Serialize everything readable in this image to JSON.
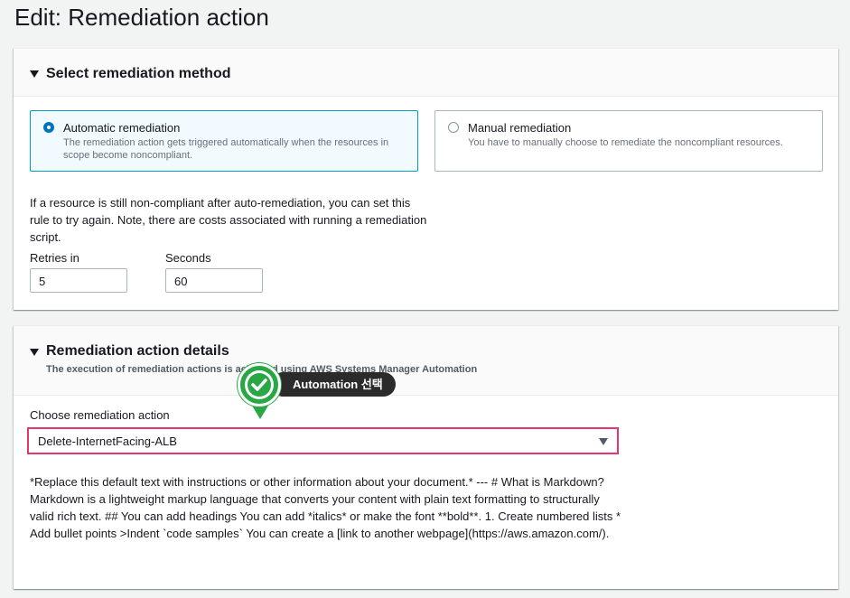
{
  "page": {
    "title": "Edit: Remediation action"
  },
  "method_panel": {
    "title": "Select remediation method",
    "options": [
      {
        "title": "Automatic remediation",
        "description": "The remediation action gets triggered automatically when the resources in scope become noncompliant.",
        "selected": true
      },
      {
        "title": "Manual remediation",
        "description": "You have to manually choose to remediate the noncompliant resources.",
        "selected": false
      }
    ],
    "retry_note": "If a resource is still non-compliant after auto-remediation, you can set this rule to try again. Note, there are costs associated with running a remediation script.",
    "retries_label": "Retries in",
    "retries_value": "5",
    "seconds_label": "Seconds",
    "seconds_value": "60"
  },
  "details_panel": {
    "title": "Remediation action details",
    "description": "The execution of remediation actions is achieved using AWS Systems Manager Automation",
    "choose_label": "Choose remediation action",
    "selected_action": "Delete-InternetFacing-ALB",
    "doc_text": "*Replace this default text with instructions or other information about your document.* --- # What is Markdown? Markdown is a lightweight markup language that converts your content with plain text formatting to structurally valid rich text. ## You can add headings You can add *italics* or make the font **bold**. 1. Create numbered lists * Add bullet points >Indent `code samples` You can create a [link to another webpage](https://aws.amazon.com/)."
  },
  "callout": {
    "text": "Automation 선택",
    "color": "#2aa745"
  },
  "colors": {
    "accent": "#0073bb",
    "highlight_border": "#e8366c"
  }
}
